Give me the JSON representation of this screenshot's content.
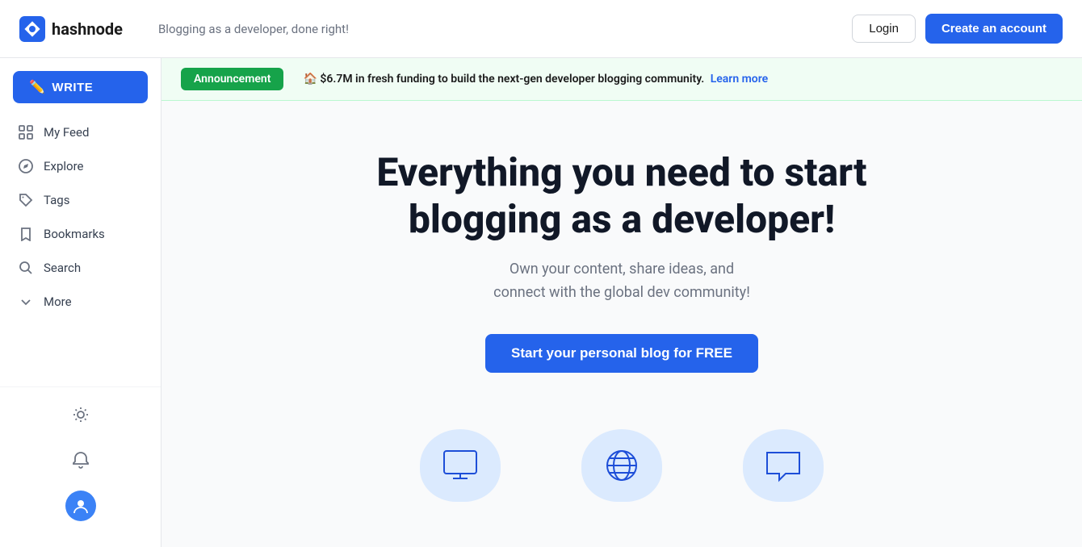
{
  "header": {
    "logo_text": "hashnode",
    "tagline": "Blogging as a developer, done right!",
    "login_label": "Login",
    "create_account_label": "Create an account"
  },
  "sidebar": {
    "write_label": "WRITE",
    "nav_items": [
      {
        "id": "my-feed",
        "label": "My Feed",
        "icon": "grid"
      },
      {
        "id": "explore",
        "label": "Explore",
        "icon": "compass"
      },
      {
        "id": "tags",
        "label": "Tags",
        "icon": "tag"
      },
      {
        "id": "bookmarks",
        "label": "Bookmarks",
        "icon": "bookmark"
      },
      {
        "id": "search",
        "label": "Search",
        "icon": "search"
      },
      {
        "id": "more",
        "label": "More",
        "icon": "chevron-down"
      }
    ]
  },
  "announcement": {
    "badge": "Announcement",
    "emoji": "🏠",
    "text": "$6.7M in fresh funding to build the next-gen developer blogging community.",
    "link_label": "Learn more"
  },
  "hero": {
    "title": "Everything you need to start blogging as a developer!",
    "subtitle": "Own your content, share ideas, and\nconnect with the global dev community!",
    "cta_label": "Start your personal blog for FREE"
  },
  "features": [
    {
      "id": "feature-1",
      "icon": "🖥️"
    },
    {
      "id": "feature-2",
      "icon": "🌐"
    },
    {
      "id": "feature-3",
      "icon": "💬"
    }
  ]
}
